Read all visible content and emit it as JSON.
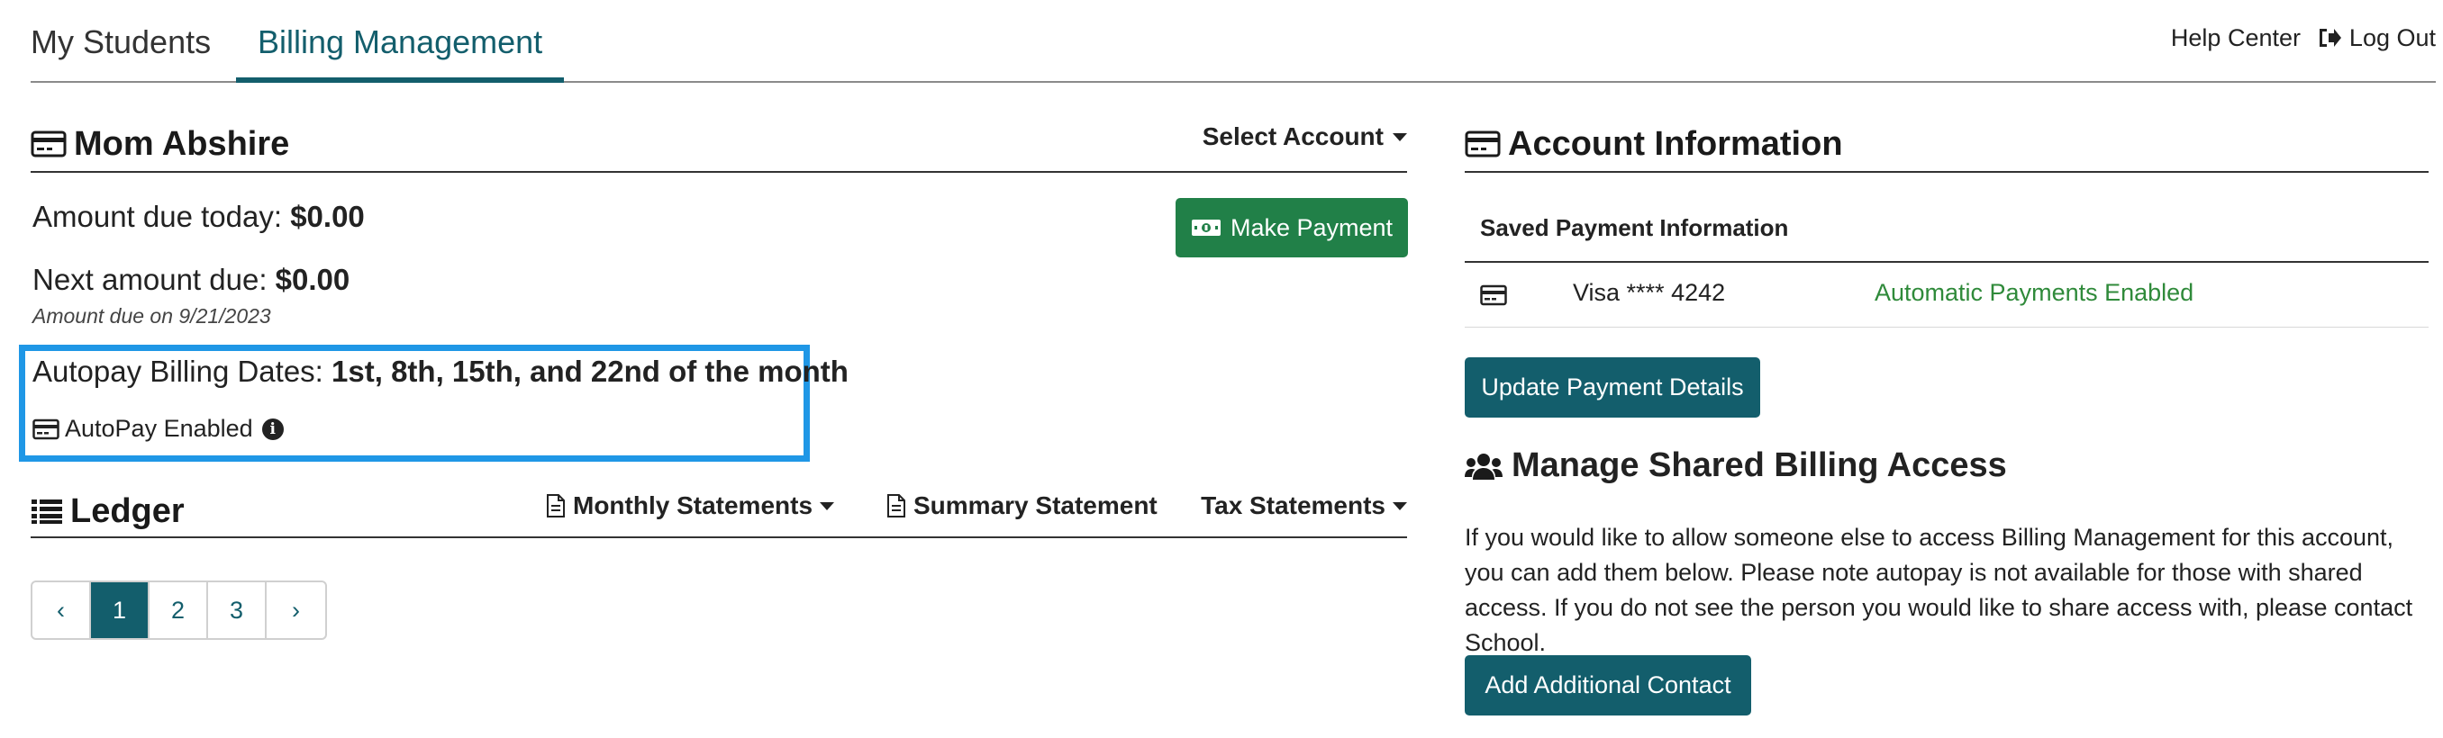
{
  "nav": {
    "tabs": [
      {
        "label": "My Students"
      },
      {
        "label": "Billing Management"
      }
    ],
    "help_label": "Help Center",
    "logout_label": "Log Out"
  },
  "account": {
    "name": "Mom Abshire",
    "select_label": "Select Account",
    "amount_today_label": "Amount due today:",
    "amount_today_value": "$0.00",
    "next_amount_label": "Next amount due:",
    "next_amount_value": "$0.00",
    "next_due_note": "Amount due on 9/21/2023",
    "make_payment_label": "Make Payment",
    "autopay_dates_label": "Autopay Billing Dates:",
    "autopay_dates_value": "1st, 8th, 15th, and 22nd of the month",
    "autopay_status": "AutoPay Enabled"
  },
  "ledger": {
    "title": "Ledger",
    "monthly_label": "Monthly Statements",
    "summary_label": "Summary Statement",
    "tax_label": "Tax Statements",
    "pagination": {
      "prev": "‹",
      "pages": [
        "1",
        "2",
        "3"
      ],
      "next": "›",
      "current": "1"
    }
  },
  "account_info": {
    "title": "Account Information",
    "saved_label": "Saved Payment Information",
    "card_number": "Visa **** 4242",
    "card_status": "Automatic Payments Enabled",
    "update_label": "Update Payment Details"
  },
  "shared_access": {
    "title": "Manage Shared Billing Access",
    "description": "If you would like to allow someone else to access Billing Management for this account, you can add them below. Please note autopay is not available for those with shared access. If you do not see the person you would like to share access with, please contact School.",
    "add_label": "Add Additional Contact"
  },
  "colors": {
    "primary": "#135e6c",
    "success_button": "#218048",
    "success_text": "#2f8a3a",
    "highlight": "#1f97e6"
  },
  "icons": [
    "credit-card-icon",
    "money-icon",
    "info-icon",
    "list-icon",
    "document-icon",
    "users-icon",
    "sign-out-icon"
  ]
}
